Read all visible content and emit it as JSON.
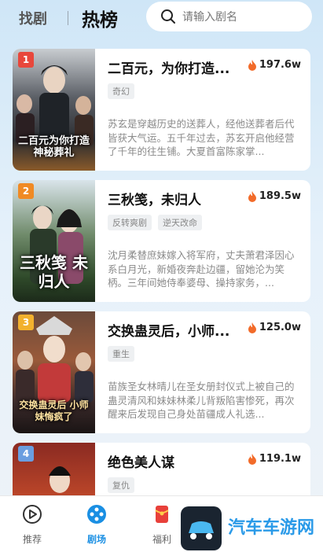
{
  "header": {
    "tab_find": "找剧",
    "tab_hot": "热榜",
    "search_placeholder": "请输入剧名"
  },
  "dramas": [
    {
      "rank": "1",
      "rank_color": "#e8473b",
      "title": "二百元，为你打造...",
      "heat": "197.6w",
      "tags": [
        "奇幻"
      ],
      "desc": "苏玄是穿越历史的送葬人，经他送葬者后代皆获大气运。五千年过去，苏玄开启他经营了千年的往生铺。大夏首富陈家掌...",
      "poster_title": "二百元为你打造 神秘葬礼"
    },
    {
      "rank": "2",
      "rank_color": "#f08a24",
      "title": "三秋笺，未归人",
      "heat": "189.5w",
      "tags": [
        "反转爽剧",
        "逆天改命"
      ],
      "desc": "沈月柔替庶妹嫁入将军府，丈夫萧君泽因心系白月光，新婚夜奔赴边疆，留她沦为笑柄。三年间她侍奉婆母、操持家务，...",
      "poster_title": "三秋笺 未归人"
    },
    {
      "rank": "3",
      "rank_color": "#f2b12e",
      "title": "交换蛊灵后，小师...",
      "heat": "125.0w",
      "tags": [
        "重生"
      ],
      "desc": "苗族圣女林晴儿在圣女册封仪式上被自己的蛊灵清风和妹妹林柔儿背叛陷害惨死，再次醒来后发现自己身处苗疆成人礼选...",
      "poster_title": "交换蛊灵后 小师妹悔疯了"
    },
    {
      "rank": "4",
      "rank_color": "#6a9ee0",
      "title": "绝色美人谋",
      "heat": "119.1w",
      "tags": [
        "复仇"
      ],
      "desc": "",
      "poster_title": ""
    }
  ],
  "nav": {
    "recommend": "推荐",
    "theater": "剧场",
    "welfare": "福利"
  },
  "watermark": "汽车车游网"
}
